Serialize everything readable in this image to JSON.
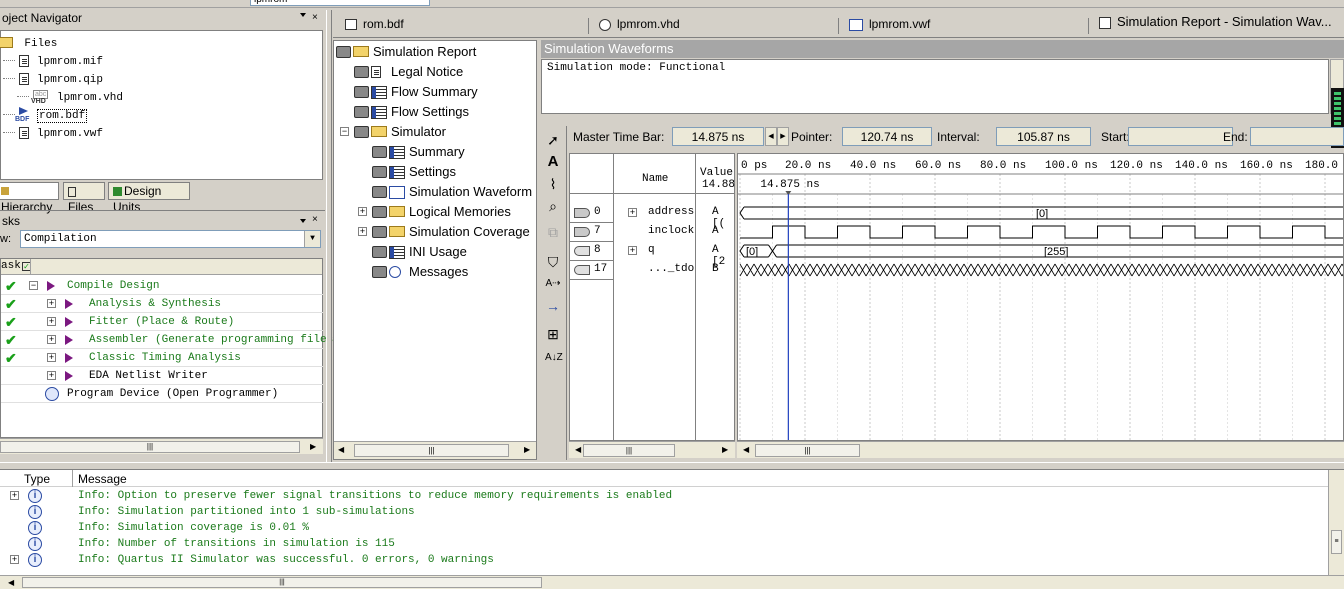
{
  "top_toolbar": {
    "combo_value": "lpmrom"
  },
  "project_navigator": {
    "title": "oject Navigator",
    "close": "×",
    "root": "Files",
    "files": [
      {
        "name": "lpmrom.mif",
        "type": "doc"
      },
      {
        "name": "lpmrom.qip",
        "type": "doc"
      },
      {
        "name": "lpmrom.vhd",
        "type": "vhd",
        "badge_top": "abc",
        "badge": "VHD"
      },
      {
        "name": "rom.bdf",
        "type": "bdf",
        "badge": "BDF"
      },
      {
        "name": "lpmrom.vwf",
        "type": "doc"
      }
    ],
    "tabs": [
      "Hierarchy",
      "Files",
      "Design Units"
    ]
  },
  "tasks": {
    "title": "sks",
    "close": "×",
    "flow_label": "w:",
    "flow_value": "Compilation",
    "column": "ask",
    "rows": [
      {
        "label": "Compile Design",
        "checked": true,
        "level": 0,
        "expander": "−"
      },
      {
        "label": "Analysis & Synthesis",
        "checked": true,
        "level": 1,
        "expander": "+"
      },
      {
        "label": "Fitter (Place & Route)",
        "checked": true,
        "level": 1,
        "expander": "+"
      },
      {
        "label": "Assembler (Generate programming files)",
        "checked": true,
        "level": 1,
        "expander": "+"
      },
      {
        "label": "Classic Timing Analysis",
        "checked": true,
        "level": 1,
        "expander": "+"
      },
      {
        "label": "EDA Netlist Writer",
        "checked": false,
        "level": 1,
        "expander": "+"
      },
      {
        "label": "Program Device (Open Programmer)",
        "checked": false,
        "level": 0,
        "expander": ""
      }
    ]
  },
  "doc_tabs": [
    {
      "label": "rom.bdf",
      "active": false
    },
    {
      "label": "lpmrom.vhd",
      "active": false
    },
    {
      "label": "lpmrom.vwf",
      "active": false
    },
    {
      "label": "Simulation Report - Simulation Wav...",
      "active": true
    }
  ],
  "doc_close": "×",
  "report_tree": {
    "items": [
      {
        "label": "Simulation Report",
        "level": 0,
        "icon": "folder",
        "expander": ""
      },
      {
        "label": "Legal Notice",
        "level": 1,
        "icon": "doc",
        "expander": ""
      },
      {
        "label": "Flow Summary",
        "level": 1,
        "icon": "table",
        "expander": ""
      },
      {
        "label": "Flow Settings",
        "level": 1,
        "icon": "table",
        "expander": ""
      },
      {
        "label": "Simulator",
        "level": 1,
        "icon": "folder",
        "expander": "−"
      },
      {
        "label": "Summary",
        "level": 2,
        "icon": "table",
        "expander": ""
      },
      {
        "label": "Settings",
        "level": 2,
        "icon": "table",
        "expander": ""
      },
      {
        "label": "Simulation Waveform",
        "level": 2,
        "icon": "wave",
        "expander": ""
      },
      {
        "label": "Logical Memories",
        "level": 2,
        "icon": "folder",
        "expander": "+"
      },
      {
        "label": "Simulation Coverage",
        "level": 2,
        "icon": "folder",
        "expander": "+"
      },
      {
        "label": "INI Usage",
        "level": 2,
        "icon": "table",
        "expander": ""
      },
      {
        "label": "Messages",
        "level": 2,
        "icon": "info",
        "expander": ""
      }
    ]
  },
  "sim_waveforms": {
    "title": "Simulation Waveforms",
    "mode_text": "Simulation mode: Functional",
    "master_time_bar_label": "Master Time Bar:",
    "master_time_bar_value": "14.875 ns",
    "pointer_label": "Pointer:",
    "pointer_value": "120.74 ns",
    "interval_label": "Interval:",
    "interval_value": "105.87 ns",
    "start_label": "Start:",
    "start_value": "",
    "end_label": "End:",
    "end_value": "",
    "col_name": "Name",
    "col_value": "Value",
    "col_value_sub": "14.88",
    "cursor_label": "14.875 ns",
    "time_ticks": [
      "0 ps",
      "20.0 ns",
      "40.0 ns",
      "60.0 ns",
      "80.0 ns",
      "100.0 ns",
      "120.0 ns",
      "140.0 ns",
      "160.0 ns",
      "180.0 ns"
    ],
    "signals": [
      {
        "index": "0",
        "expander": "+",
        "name": "address",
        "value": "A [(",
        "dir": "in"
      },
      {
        "index": "7",
        "expander": "",
        "name": "inclock",
        "value": "A",
        "dir": "in"
      },
      {
        "index": "8",
        "expander": "+",
        "name": "q",
        "value": "A [2",
        "dir": "out"
      },
      {
        "index": "17",
        "expander": "",
        "name": "..._tdo",
        "value": "B",
        "dir": "out"
      }
    ],
    "bus_labels": {
      "address": "[0]",
      "q_first": "[0]",
      "q_second": "[255]"
    }
  },
  "messages": {
    "col_type": "Type",
    "col_message": "Message",
    "rows": [
      {
        "expander": "+",
        "text": "Info: Option to preserve fewer signal transitions to reduce memory requirements is enabled"
      },
      {
        "expander": "",
        "text": "Info: Simulation partitioned into 1 sub-simulations"
      },
      {
        "expander": "",
        "text": "Info: Simulation coverage is       0.01 %"
      },
      {
        "expander": "",
        "text": "Info: Number of transitions in simulation is 115"
      },
      {
        "expander": "+",
        "text": "Info: Quartus II Simulator was successful. 0 errors, 0 warnings"
      }
    ]
  },
  "colors": {
    "accent": "#0a246a",
    "green_text": "#1a7a1a",
    "cursor": "#1f3fbf"
  }
}
